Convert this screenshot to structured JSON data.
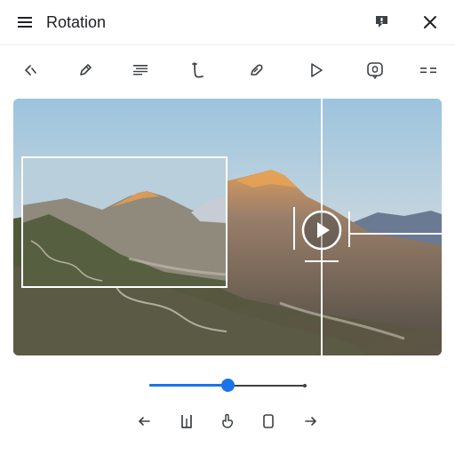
{
  "header": {
    "title": "Rotation",
    "menu_icon": "hamburger-menu-icon",
    "feedback_icon": "feedback-icon",
    "close_icon": "close-icon"
  },
  "toolbar": {
    "items": [
      {
        "icon": "back-chevron-icon"
      },
      {
        "icon": "pen-icon"
      },
      {
        "icon": "text-lines-icon"
      },
      {
        "icon": "curve-tool-icon"
      },
      {
        "icon": "link-icon"
      },
      {
        "icon": "play-icon"
      },
      {
        "icon": "screenshot-icon"
      },
      {
        "icon": "equals-icon"
      }
    ]
  },
  "canvas": {
    "image_icon": "mountain-landscape-image",
    "overlay_control_icon": "play-circle-icon"
  },
  "slider": {
    "value_fraction": 0.5,
    "fill_color": "#1a73e8",
    "track_color": "#3c4043"
  },
  "bottom_controls": [
    {
      "icon": "arrow-left-icon"
    },
    {
      "icon": "bracket-icon"
    },
    {
      "icon": "hand-icon"
    },
    {
      "icon": "rectangle-icon"
    },
    {
      "icon": "arrow-right-icon"
    }
  ],
  "colors": {
    "accent": "#1a73e8",
    "text": "#202124",
    "divider": "#eeeeee"
  }
}
